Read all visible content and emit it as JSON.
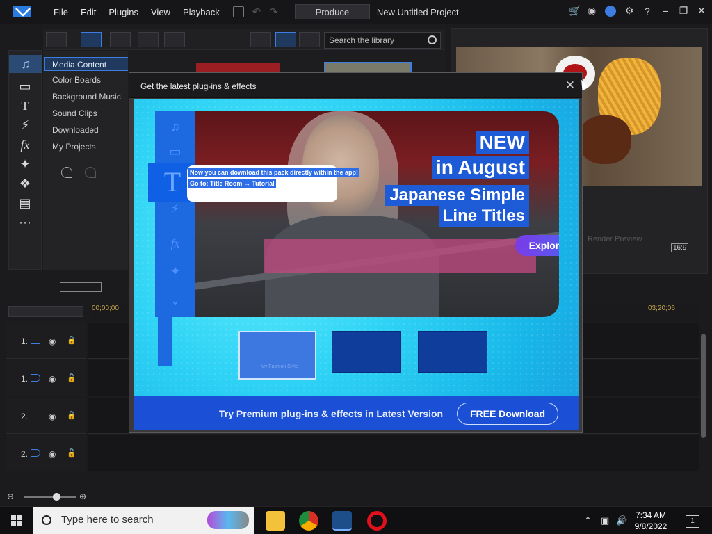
{
  "app": {
    "menu": [
      "File",
      "Edit",
      "Plugins",
      "View",
      "Playback"
    ],
    "produce_label": "Produce",
    "project_title": "New Untitled Project"
  },
  "library": {
    "search_placeholder": "Search the library",
    "categories": [
      "Media Content",
      "Color Boards",
      "Background Music",
      "Sound Clips",
      "Downloaded",
      "My Projects"
    ]
  },
  "preview": {
    "render_label": "Render Preview",
    "aspect_ratio": "16:9"
  },
  "timeline": {
    "start_time": "00;00;00",
    "end_time": "03;20;06",
    "tracks": [
      "1.",
      "1.",
      "2.",
      "2."
    ]
  },
  "dialog": {
    "title": "Get the latest plug-ins & effects",
    "notification_line1": "Now you can download this pack directly within the app!",
    "notification_line2": "Go to: Title Room → Tutorial",
    "headline_new": "NEW",
    "headline_month": "in August",
    "headline_product1": "Japanese Simple",
    "headline_product2": "Line Titles",
    "explore_label": "Explore More",
    "thumb_caption": "My Fashion Style",
    "footer_text": "Try Premium plug-ins & effects in Latest Version",
    "download_label": "FREE Download"
  },
  "taskbar": {
    "search_placeholder": "Type here to search",
    "time": "7:34 AM",
    "date": "9/8/2022",
    "notification_count": "1"
  }
}
